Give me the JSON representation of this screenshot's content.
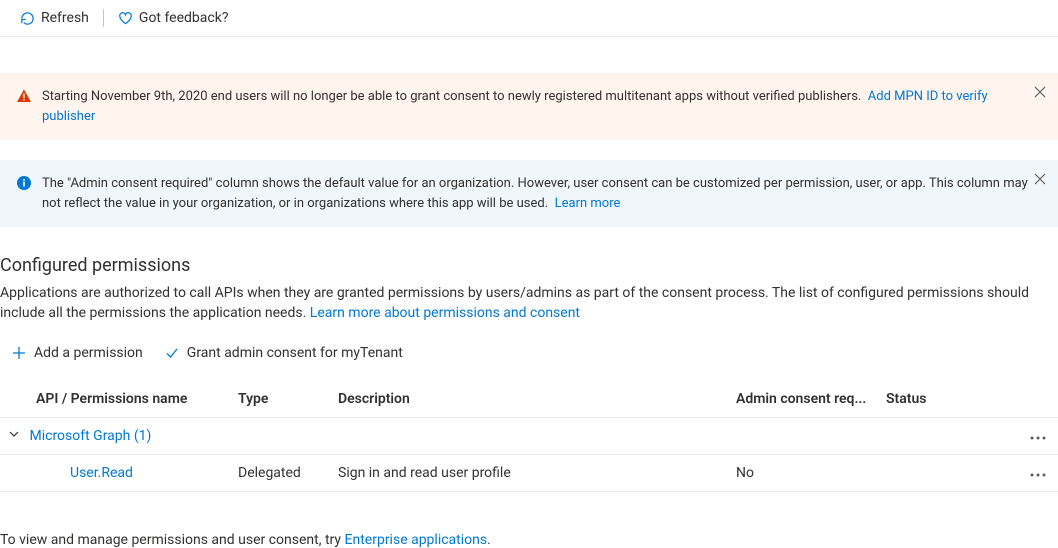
{
  "toolbar": {
    "refresh": "Refresh",
    "feedback": "Got feedback?"
  },
  "banners": {
    "warning": {
      "text": "Starting November 9th, 2020 end users will no longer be able to grant consent to newly registered multitenant apps without verified publishers.",
      "link": "Add MPN ID to verify publisher"
    },
    "info": {
      "text": "The \"Admin consent required\" column shows the default value for an organization. However, user consent can be customized per permission, user, or app. This column may not reflect the value in your organization, or in organizations where this app will be used.",
      "link": "Learn more"
    }
  },
  "section": {
    "title": "Configured permissions",
    "description": "Applications are authorized to call APIs when they are granted permissions by users/admins as part of the consent process. The list of configured permissions should include all the permissions the application needs.",
    "learnMore": "Learn more about permissions and consent"
  },
  "actions": {
    "add": "Add a permission",
    "grant": "Grant admin consent for myTenant"
  },
  "table": {
    "headers": {
      "name": "API / Permissions name",
      "type": "Type",
      "description": "Description",
      "admin": "Admin consent req...",
      "status": "Status"
    },
    "group": {
      "label": "Microsoft Graph (1)"
    },
    "rows": [
      {
        "name": "User.Read",
        "type": "Delegated",
        "description": "Sign in and read user profile",
        "admin": "No",
        "status": ""
      }
    ]
  },
  "footer": {
    "text": "To view and manage permissions and user consent, try",
    "link": "Enterprise applications",
    "suffix": "."
  }
}
